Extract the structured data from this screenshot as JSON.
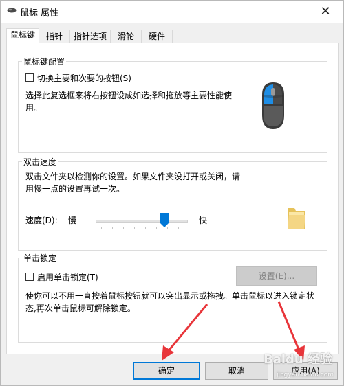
{
  "window": {
    "title": "鼠标 属性",
    "close_glyph": "✕",
    "icon": "mouse-icon"
  },
  "tabs": [
    {
      "label": "鼠标键",
      "active": true
    },
    {
      "label": "指针"
    },
    {
      "label": "指针选项"
    },
    {
      "label": "滑轮"
    },
    {
      "label": "硬件"
    }
  ],
  "button_config": {
    "title": "鼠标键配置",
    "checkbox_label": "切换主要和次要的按钮(S)",
    "checked": false,
    "description": "选择此复选框来将右按钮设成如选择和拖放等主要性能使用。",
    "image_icon": "mouse-illustration-icon"
  },
  "double_click": {
    "title": "双击速度",
    "description": "双击文件夹以检测你的设置。如果文件夹没打开或关闭，请用慢一点的设置再试一次。",
    "speed_label": "速度(D):",
    "slow_label": "慢",
    "fast_label": "快",
    "speed_value_fraction": 0.77,
    "folder_icon": "folder-icon"
  },
  "click_lock": {
    "title": "单击锁定",
    "checkbox_label": "启用单击锁定(T)",
    "checked": false,
    "settings_button": "设置(E)...",
    "settings_enabled": false,
    "description": "使你可以不用一直按着鼠标按钮就可以突出显示或拖拽。单击鼠标以进入锁定状态,再次单击鼠标可解除锁定。"
  },
  "footer": {
    "ok_label": "确定",
    "cancel_label": "取消",
    "apply_label": "应用(A)"
  },
  "annotations": {
    "arrow_color": "#e8353a"
  },
  "watermark": {
    "text": "Baidu 经验",
    "sub": "jingyan.baidu.com"
  }
}
